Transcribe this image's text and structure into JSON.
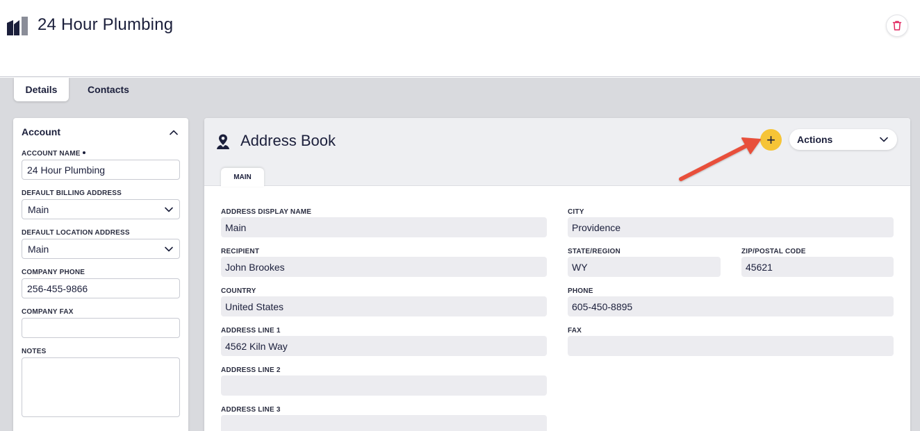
{
  "header": {
    "title": "24 Hour Plumbing"
  },
  "tabs": [
    {
      "label": "Details"
    },
    {
      "label": "Contacts"
    }
  ],
  "account": {
    "heading": "Account",
    "fields": {
      "account_name": {
        "label": "ACCOUNT NAME",
        "value": "24 Hour Plumbing"
      },
      "default_billing": {
        "label": "DEFAULT BILLING ADDRESS",
        "value": "Main"
      },
      "default_location": {
        "label": "DEFAULT LOCATION ADDRESS",
        "value": "Main"
      },
      "company_phone": {
        "label": "COMPANY PHONE",
        "value": "256-455-9866"
      },
      "company_fax": {
        "label": "COMPANY FAX",
        "value": ""
      },
      "notes": {
        "label": "NOTES",
        "value": ""
      }
    }
  },
  "address_book": {
    "title": "Address Book",
    "actions_label": "Actions",
    "tab": "MAIN",
    "add_symbol": "+",
    "fields": {
      "display_name": {
        "label": "ADDRESS DISPLAY NAME",
        "value": "Main"
      },
      "recipient": {
        "label": "RECIPIENT",
        "value": "John Brookes"
      },
      "country": {
        "label": "COUNTRY",
        "value": "United States"
      },
      "line1": {
        "label": "ADDRESS LINE 1",
        "value": "4562 Kiln Way"
      },
      "line2": {
        "label": "ADDRESS LINE 2",
        "value": ""
      },
      "line3": {
        "label": "ADDRESS LINE 3",
        "value": ""
      },
      "city": {
        "label": "CITY",
        "value": "Providence"
      },
      "state": {
        "label": "STATE/REGION",
        "value": "WY"
      },
      "zip": {
        "label": "ZIP/POSTAL CODE",
        "value": "45621"
      },
      "phone": {
        "label": "PHONE",
        "value": "605-450-8895"
      },
      "fax": {
        "label": "FAX",
        "value": ""
      }
    }
  },
  "colors": {
    "accent_yellow": "#f6c437",
    "navy": "#1b1f3b",
    "delete_red": "#e0245e",
    "annotation_arrow": "#e8503a",
    "background_gray": "#d9dade"
  },
  "icons": {
    "logo": "building-logo-icon",
    "delete": "trash-icon",
    "address_book": "map-pin-user-icon",
    "collapse": "chevron-up-icon",
    "dropdown": "chevron-down-icon"
  }
}
